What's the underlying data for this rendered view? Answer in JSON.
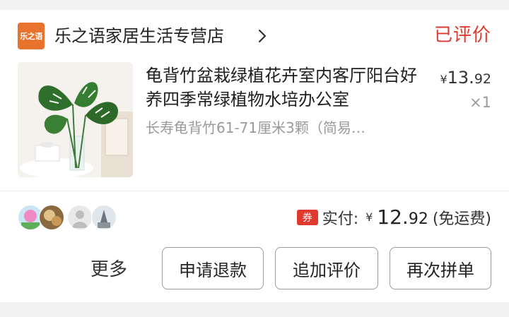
{
  "store": {
    "logo_text": "乐之语",
    "name": "乐之语家居生活专营店",
    "status": "已评价"
  },
  "product": {
    "title": "龟背竹盆栽绿植花卉室内客厅阳台好养四季常绿植物水培办公室",
    "spec": "长寿龟背竹61-71厘米3颗（简易…",
    "price_currency": "¥",
    "price_int": "13.",
    "price_dec": "92",
    "quantity": "×1"
  },
  "payment": {
    "coupon_icon": "券",
    "label": "实付:",
    "currency": "¥",
    "amount_int": "12.",
    "amount_dec": "92",
    "note": "(免运费)"
  },
  "actions": {
    "more": "更多",
    "refund": "申请退款",
    "add_review": "追加评价",
    "rebuy": "再次拼单"
  },
  "colors": {
    "status_red": "#e0392d",
    "logo_orange": "#e8732c"
  },
  "icons": {
    "store_chevron": "chevron-right-icon",
    "coupon": "coupon-icon"
  }
}
